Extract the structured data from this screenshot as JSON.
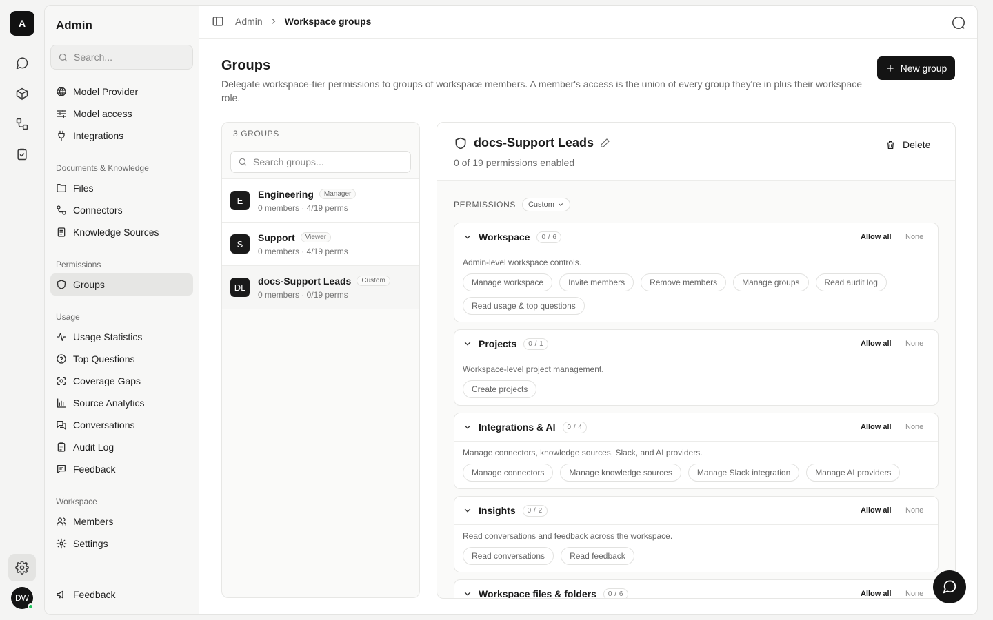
{
  "rail": {
    "logo": "A",
    "avatar": "DW"
  },
  "sidebar": {
    "title": "Admin",
    "search_placeholder": "Search...",
    "top_items": [
      {
        "label": "Model Provider",
        "icon": "globe-icon"
      },
      {
        "label": "Model access",
        "icon": "sliders-icon"
      },
      {
        "label": "Integrations",
        "icon": "plug-icon"
      }
    ],
    "sections": [
      {
        "title": "Documents & Knowledge",
        "items": [
          {
            "label": "Files",
            "icon": "folder-icon"
          },
          {
            "label": "Connectors",
            "icon": "connector-icon"
          },
          {
            "label": "Knowledge Sources",
            "icon": "book-icon"
          }
        ]
      },
      {
        "title": "Permissions",
        "items": [
          {
            "label": "Groups",
            "icon": "shield-icon"
          }
        ]
      },
      {
        "title": "Usage",
        "items": [
          {
            "label": "Usage Statistics",
            "icon": "activity-icon"
          },
          {
            "label": "Top Questions",
            "icon": "help-circle-icon"
          },
          {
            "label": "Coverage Gaps",
            "icon": "scan-icon"
          },
          {
            "label": "Source Analytics",
            "icon": "bar-chart-icon"
          },
          {
            "label": "Conversations",
            "icon": "messages-icon"
          },
          {
            "label": "Audit Log",
            "icon": "clipboard-icon"
          },
          {
            "label": "Feedback",
            "icon": "message-square-icon"
          }
        ]
      },
      {
        "title": "Workspace",
        "items": [
          {
            "label": "Members",
            "icon": "users-icon"
          },
          {
            "label": "Settings",
            "icon": "gear-icon"
          }
        ]
      }
    ],
    "footer_label": "Feedback"
  },
  "topbar": {
    "crumb_parent": "Admin",
    "crumb_current": "Workspace groups"
  },
  "page": {
    "title": "Groups",
    "description": "Delegate workspace-tier permissions to groups of workspace members. A member's access is the union of every group they're in plus their workspace role.",
    "new_button": "New group"
  },
  "groups_panel": {
    "header": "3 GROUPS",
    "search_placeholder": "Search groups...",
    "groups": [
      {
        "avatar": "E",
        "name": "Engineering",
        "badge": "Manager",
        "meta": "0 members · 4/19 perms"
      },
      {
        "avatar": "S",
        "name": "Support",
        "badge": "Viewer",
        "meta": "0 members · 4/19 perms"
      },
      {
        "avatar": "DL",
        "name": "docs-Support Leads",
        "badge": "Custom",
        "meta": "0 members · 0/19 perms"
      }
    ]
  },
  "detail": {
    "title": "docs-Support Leads",
    "subtitle": "0 of 19 permissions enabled",
    "delete_label": "Delete",
    "permissions_label": "PERMISSIONS",
    "mode": "Custom",
    "allow_all": "Allow all",
    "none": "None",
    "cards": [
      {
        "title": "Workspace",
        "count": "0 / 6",
        "desc": "Admin-level workspace controls.",
        "chips": [
          "Manage workspace",
          "Invite members",
          "Remove members",
          "Manage groups",
          "Read audit log",
          "Read usage & top questions"
        ]
      },
      {
        "title": "Projects",
        "count": "0 / 1",
        "desc": "Workspace-level project management.",
        "chips": [
          "Create projects"
        ]
      },
      {
        "title": "Integrations & AI",
        "count": "0 / 4",
        "desc": "Manage connectors, knowledge sources, Slack, and AI providers.",
        "chips": [
          "Manage connectors",
          "Manage knowledge sources",
          "Manage Slack integration",
          "Manage AI providers"
        ]
      },
      {
        "title": "Insights",
        "count": "0 / 2",
        "desc": "Read conversations and feedback across the workspace.",
        "chips": [
          "Read conversations",
          "Read feedback"
        ]
      },
      {
        "title": "Workspace files & folders",
        "count": "0 / 6",
        "desc": "",
        "chips": []
      }
    ]
  }
}
